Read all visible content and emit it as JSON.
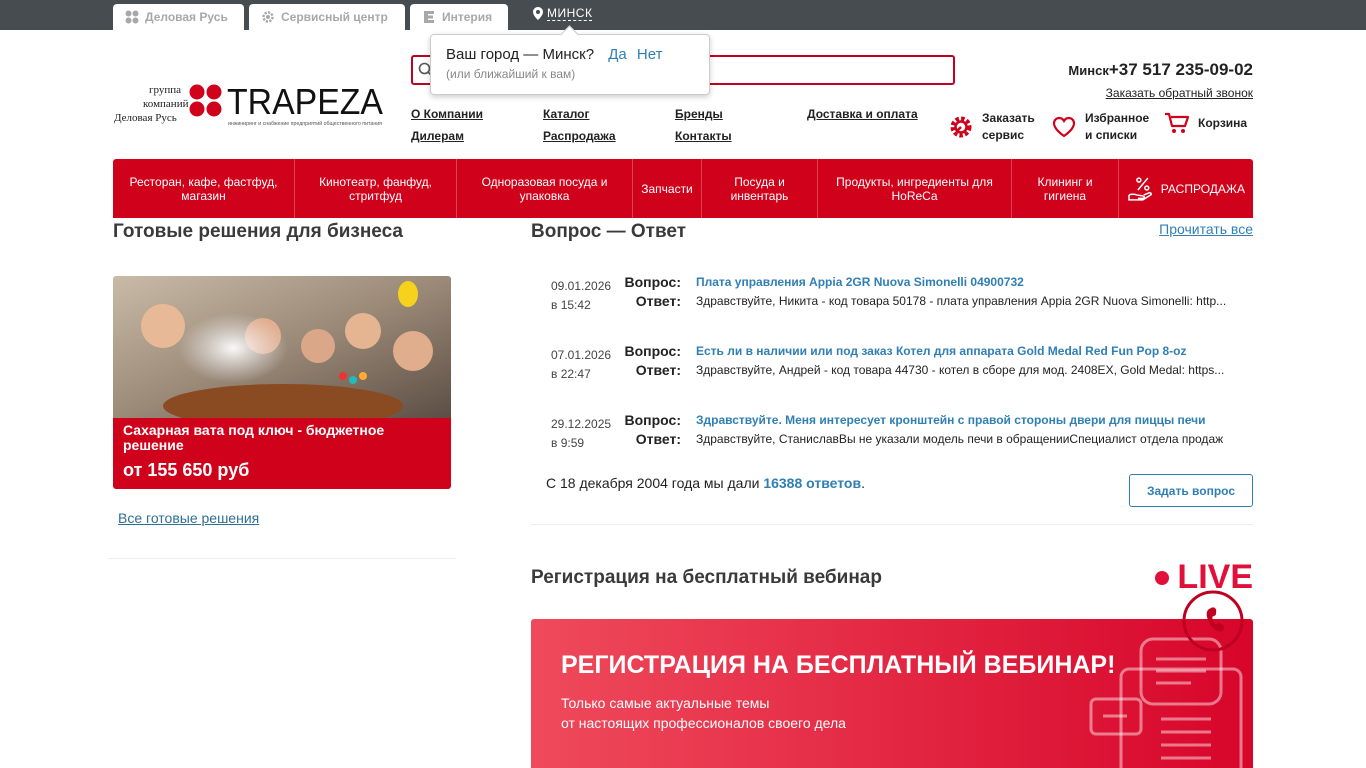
{
  "topbar": {
    "tabs": [
      {
        "label": "Деловая Русь"
      },
      {
        "label": "Сервисный центр"
      },
      {
        "label": "Интерия"
      }
    ],
    "city": "МИНСК"
  },
  "logo": {
    "group_line1": "группа",
    "group_line2": "компаний",
    "group_line3": "Деловая Русь",
    "brand": "TRAPEZA",
    "tagline": "инжиниринг и снабжение предприятий общественного питания"
  },
  "city_popup": {
    "question": "Ваш город — Минск?",
    "yes": "Да",
    "no": "Нет",
    "note": "(или ближайший к вам)"
  },
  "nav": {
    "about": "О Компании",
    "catalog": "Каталог",
    "brands": "Бренды",
    "delivery": "Доставка и оплата",
    "dealers": "Дилерам",
    "sale": "Распродажа",
    "contacts": "Контакты"
  },
  "contact": {
    "city": "Минск",
    "phone": "+37 517 235-09-02",
    "callback": "Заказать обратный звонок"
  },
  "actions": {
    "service_l1": "Заказать",
    "service_l2": "сервис",
    "fav_l1": "Избранное",
    "fav_l2": "и списки",
    "cart": "Корзина"
  },
  "menu": [
    {
      "label": "Ресторан, кафе, фастфуд, магазин"
    },
    {
      "label": "Кинотеатр, фанфуд, стритфуд"
    },
    {
      "label": "Одноразовая посуда и упаковка"
    },
    {
      "label": "Запчасти"
    },
    {
      "label": "Посуда и инвентарь"
    },
    {
      "label": "Продукты, ингредиенты для HoReCa"
    },
    {
      "label": "Клининг и гигиена"
    },
    {
      "label": "РАСПРОДАЖА"
    }
  ],
  "solutions": {
    "heading": "Готовые решения для бизнеса",
    "promo_title": "Сахарная вата под ключ - бюджетное решение",
    "promo_price": "от 155 650 руб",
    "all_link": "Все готовые решения"
  },
  "faq": {
    "heading": "Вопрос — Ответ",
    "read_all": "Прочитать все",
    "q_label": "Вопрос:",
    "a_label": "Ответ:",
    "items": [
      {
        "date": "09.01.2026",
        "time": "в 15:42",
        "question": "Плата управления Appia 2GR Nuova Simonelli 04900732",
        "answer": "Здравствуйте, Никита - код товара 50178 - плата управления Appia 2GR Nuova Simonelli: http..."
      },
      {
        "date": "07.01.2026",
        "time": "в 22:47",
        "question": "Есть ли в наличии или под заказ Котел для аппарата Gold Medal Red Fun Pop 8-oz",
        "answer": "Здравствуйте, Андрей - код товара 44730 - котел в сборе для мод. 2408EX, Gold Medal: https..."
      },
      {
        "date": "29.12.2025",
        "time": "в 9:59",
        "question": "Здравствуйте. Меня интересует кронштейн с правой стороны двери для пиццы печи",
        "answer": "Здравствуйте, СтаниславВы не указали модель печи в обращенииСпециалист отдела продаж"
      }
    ],
    "stats_prefix": "С 18 декабря 2004 года мы дали",
    "stats_count": "16388 ответов",
    "stats_suffix": ".",
    "ask_button": "Задать вопрос"
  },
  "webinar": {
    "heading": "Регистрация на бесплатный вебинар",
    "live": "LIVE",
    "banner_title": "РЕГИСТРАЦИЯ НА БЕСПЛАТНЫЙ ВЕБИНАР!",
    "banner_sub1": "Только самые актуальные темы",
    "banner_sub2": "от настоящих профессионалов своего дела"
  },
  "colors": {
    "brand_red": "#d0021b",
    "link_blue": "#2f7fb5",
    "topbar": "#474c50"
  }
}
